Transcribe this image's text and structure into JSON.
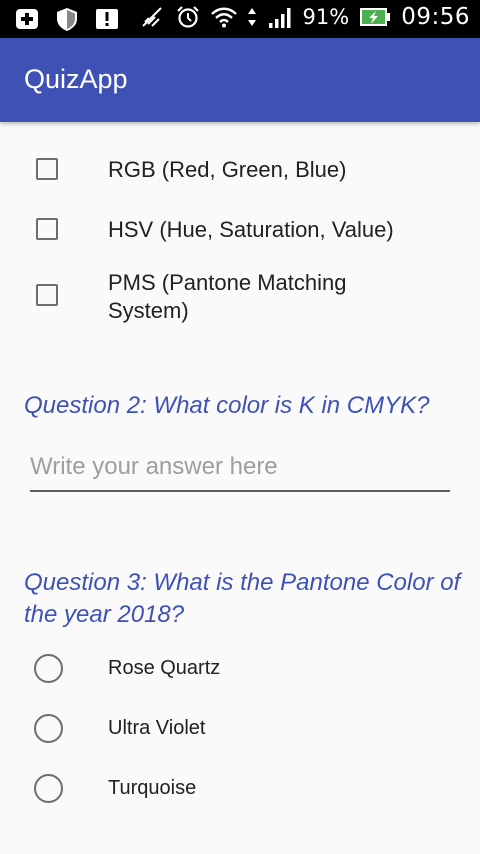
{
  "status_bar": {
    "left_icons": [
      "add-notification-icon",
      "shield-icon",
      "alert-icon"
    ],
    "right_icons": [
      "mute-icon",
      "alarm-icon",
      "wifi-icon",
      "data-arrows-icon",
      "signal-icon"
    ],
    "battery_percent": "91%",
    "time": "09:56"
  },
  "app_bar": {
    "title": "QuizApp",
    "color": "#3f51b5"
  },
  "question1": {
    "options": [
      {
        "label": "RGB (Red, Green, Blue)",
        "checked": false
      },
      {
        "label": "HSV (Hue, Saturation, Value)",
        "checked": false
      },
      {
        "label": "PMS (Pantone Matching System)",
        "checked": false
      }
    ]
  },
  "question2": {
    "text": "Question 2: What color is K in CMYK?",
    "answer_value": "",
    "answer_placeholder": "Write your answer here"
  },
  "question3": {
    "text": "Question 3: What is the Pantone Color of the year 2018?",
    "options": [
      {
        "label": "Rose Quartz",
        "selected": false
      },
      {
        "label": "Ultra Violet",
        "selected": false
      },
      {
        "label": "Turquoise",
        "selected": false
      }
    ]
  }
}
